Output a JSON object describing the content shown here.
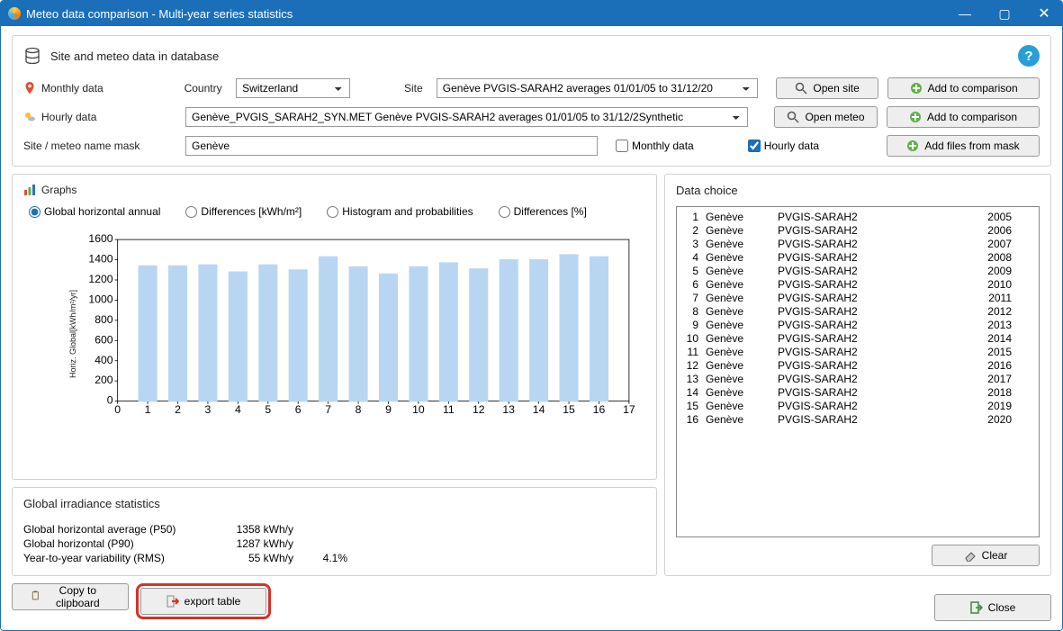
{
  "window": {
    "title": "Meteo data comparison - Multi-year series statistics"
  },
  "top": {
    "heading": "Site and meteo data in database",
    "monthly_label": "Monthly data",
    "hourly_label": "Hourly data",
    "mask_label": "Site / meteo name mask",
    "country_label": "Country",
    "country_value": "Switzerland",
    "site_label": "Site",
    "site_value": "Genève               PVGIS-SARAH2 averages 01/01/05 to 31/12/20",
    "hourly_value": "Genève_PVGIS_SARAH2_SYN.MET    Genève                        PVGIS-SARAH2 averages 01/01/05 to 31/12/2Synthetic",
    "mask_value": "Genève",
    "monthly_check": "Monthly data",
    "hourly_check": "Hourly data",
    "open_site": "Open site",
    "open_meteo": "Open meteo",
    "add_comparison": "Add to comparison",
    "add_files": "Add files from mask"
  },
  "graphs": {
    "title": "Graphs",
    "r1": "Global horizontal annual",
    "r2": "Differences [kWh/m²]",
    "r3": "Histogram and probabilities",
    "r4": "Differences [%]",
    "ylabel": "Horiz. Global[kWh/m²/yr]"
  },
  "chart_data": {
    "type": "bar",
    "categories": [
      "1",
      "2",
      "3",
      "4",
      "5",
      "6",
      "7",
      "8",
      "9",
      "10",
      "11",
      "12",
      "13",
      "14",
      "15",
      "16"
    ],
    "values": [
      1340,
      1340,
      1350,
      1280,
      1350,
      1300,
      1430,
      1330,
      1260,
      1330,
      1370,
      1310,
      1400,
      1400,
      1450,
      1430
    ],
    "title": "",
    "xlabel": "",
    "ylabel": "Horiz. Global[kWh/m²/yr]",
    "ylim": [
      0,
      1600
    ],
    "xticks": [
      "0",
      "1",
      "2",
      "3",
      "4",
      "5",
      "6",
      "7",
      "8",
      "9",
      "10",
      "11",
      "12",
      "13",
      "14",
      "15",
      "16",
      "17"
    ],
    "yticks": [
      "0",
      "200",
      "400",
      "600",
      "800",
      "1000",
      "1200",
      "1400",
      "1600"
    ]
  },
  "data_choice": {
    "title": "Data choice",
    "items": [
      {
        "n": "1",
        "site": "Genève",
        "src": "PVGIS-SARAH2",
        "year": "2005"
      },
      {
        "n": "2",
        "site": "Genève",
        "src": "PVGIS-SARAH2",
        "year": "2006"
      },
      {
        "n": "3",
        "site": "Genève",
        "src": "PVGIS-SARAH2",
        "year": "2007"
      },
      {
        "n": "4",
        "site": "Genève",
        "src": "PVGIS-SARAH2",
        "year": "2008"
      },
      {
        "n": "5",
        "site": "Genève",
        "src": "PVGIS-SARAH2",
        "year": "2009"
      },
      {
        "n": "6",
        "site": "Genève",
        "src": "PVGIS-SARAH2",
        "year": "2010"
      },
      {
        "n": "7",
        "site": "Genève",
        "src": "PVGIS-SARAH2",
        "year": "2011"
      },
      {
        "n": "8",
        "site": "Genève",
        "src": "PVGIS-SARAH2",
        "year": "2012"
      },
      {
        "n": "9",
        "site": "Genève",
        "src": "PVGIS-SARAH2",
        "year": "2013"
      },
      {
        "n": "10",
        "site": "Genève",
        "src": "PVGIS-SARAH2",
        "year": "2014"
      },
      {
        "n": "11",
        "site": "Genève",
        "src": "PVGIS-SARAH2",
        "year": "2015"
      },
      {
        "n": "12",
        "site": "Genève",
        "src": "PVGIS-SARAH2",
        "year": "2016"
      },
      {
        "n": "13",
        "site": "Genève",
        "src": "PVGIS-SARAH2",
        "year": "2017"
      },
      {
        "n": "14",
        "site": "Genève",
        "src": "PVGIS-SARAH2",
        "year": "2018"
      },
      {
        "n": "15",
        "site": "Genève",
        "src": "PVGIS-SARAH2",
        "year": "2019"
      },
      {
        "n": "16",
        "site": "Genève",
        "src": "PVGIS-SARAH2",
        "year": "2020"
      }
    ],
    "clear": "Clear"
  },
  "stats": {
    "title": "Global irradiance statistics",
    "rows": [
      {
        "k": "Global horizontal average (P50)",
        "v": "1358 kWh/y",
        "p": ""
      },
      {
        "k": "Global horizontal (P90)",
        "v": "1287 kWh/y",
        "p": ""
      },
      {
        "k": "Year-to-year variability (RMS)",
        "v": "55 kWh/y",
        "p": "4.1%"
      }
    ]
  },
  "bottom": {
    "copy": "Copy to clipboard",
    "export": "export table",
    "close": "Close"
  }
}
